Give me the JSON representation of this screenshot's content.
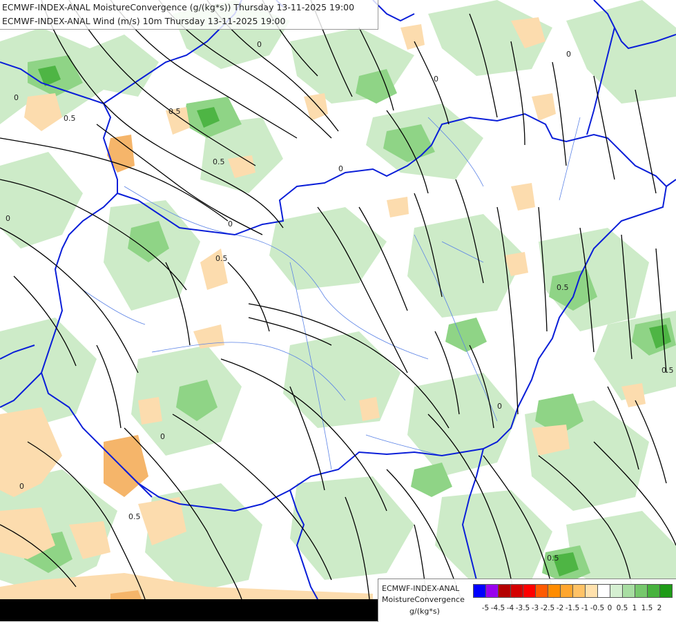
{
  "title": {
    "line1": "ECMWF-INDEX-ANAL MoistureConvergence (g/(kg*s)) Thursday 13-11-2025 19:00",
    "line2": "ECMWF-INDEX-ANAL Wind (m/s) 10m Thursday 13-11-2025 19:00"
  },
  "legend": {
    "model": "ECMWF-INDEX-ANAL",
    "parameter": "MoistureConvergence",
    "unit": "g/(kg*s)",
    "colors": [
      "#0000ff",
      "#9900ee",
      "#b40000",
      "#d40000",
      "#ff0000",
      "#ff5a00",
      "#ff8c00",
      "#ffa62e",
      "#ffc266",
      "#ffe1ad",
      "#ffffff",
      "#d5f0d1",
      "#a8dea2",
      "#76c86c",
      "#47b23d",
      "#1e9b17"
    ],
    "ticks": [
      "-5",
      "-4.5",
      "-4",
      "-3.5",
      "-3",
      "-2.5",
      "-2",
      "-1.5",
      "-1",
      "-0.5",
      "0",
      "0.5",
      "1",
      "1.5",
      "2"
    ]
  },
  "map": {
    "contour_labels": [
      "0",
      "0.5",
      "0",
      "0.5",
      "0",
      "0.5",
      "0",
      "0",
      "0.5",
      "0",
      "0.5",
      "0",
      "0",
      "0.5",
      "0",
      "0.5",
      "0",
      "0.5"
    ],
    "colors": {
      "background": "#ffffff",
      "convergence_light": "#cdebc8",
      "convergence_mid": "#8fd486",
      "convergence_strong": "#4eb544",
      "divergence_light": "#fcdcae",
      "divergence_mid": "#f5b56a",
      "border": "#0a1ed8",
      "river": "#5a82e6",
      "streamline": "#000000"
    }
  }
}
